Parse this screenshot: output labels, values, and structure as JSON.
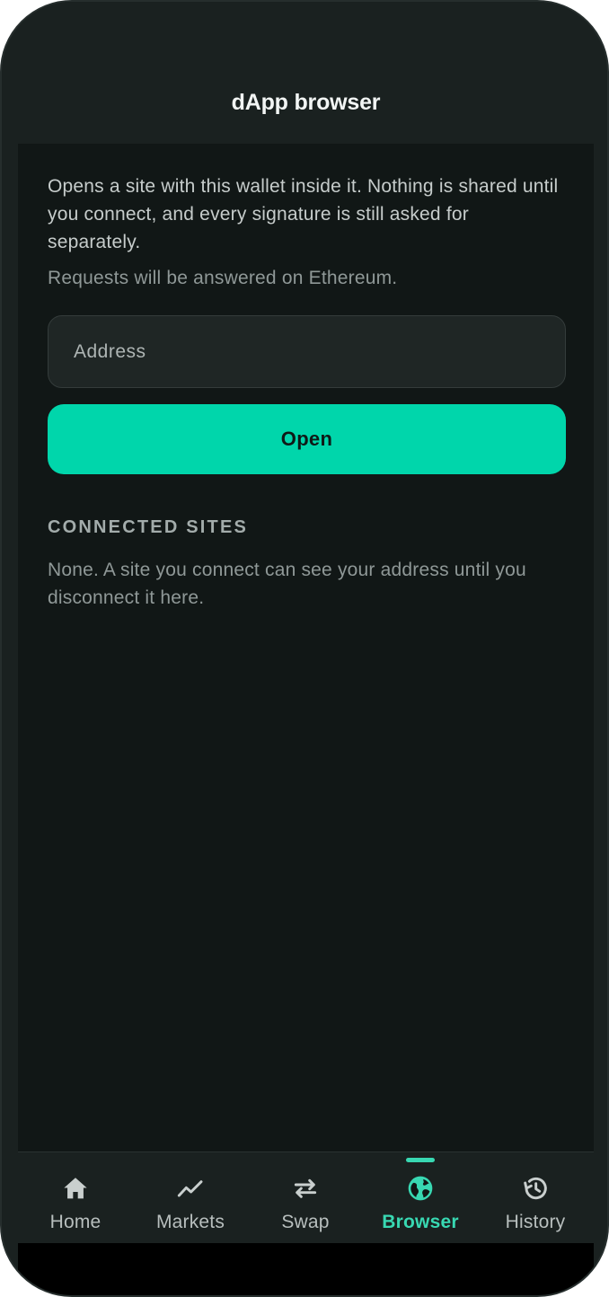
{
  "header": {
    "title": "dApp browser"
  },
  "intro": {
    "description": "Opens a site with this wallet inside it. Nothing is shared until you connect, and every signature is still asked for separately.",
    "network_note": "Requests will be answered on Ethereum."
  },
  "address_input": {
    "placeholder": "Address",
    "value": ""
  },
  "open_button": {
    "label": "Open"
  },
  "connected_sites": {
    "heading": "CONNECTED SITES",
    "empty_message": "None. A site you connect can see your address until you disconnect it here."
  },
  "bottom_nav": {
    "active": "Browser",
    "items": [
      {
        "label": "Home",
        "icon": "home-icon"
      },
      {
        "label": "Markets",
        "icon": "trend-line-icon"
      },
      {
        "label": "Swap",
        "icon": "swap-arrows-icon"
      },
      {
        "label": "Browser",
        "icon": "globe-icon"
      },
      {
        "label": "History",
        "icon": "history-icon"
      }
    ]
  },
  "colors": {
    "accent": "#00d6ab",
    "nav_active": "#38d8b2",
    "background": "#111716",
    "surface": "#1a2120"
  }
}
